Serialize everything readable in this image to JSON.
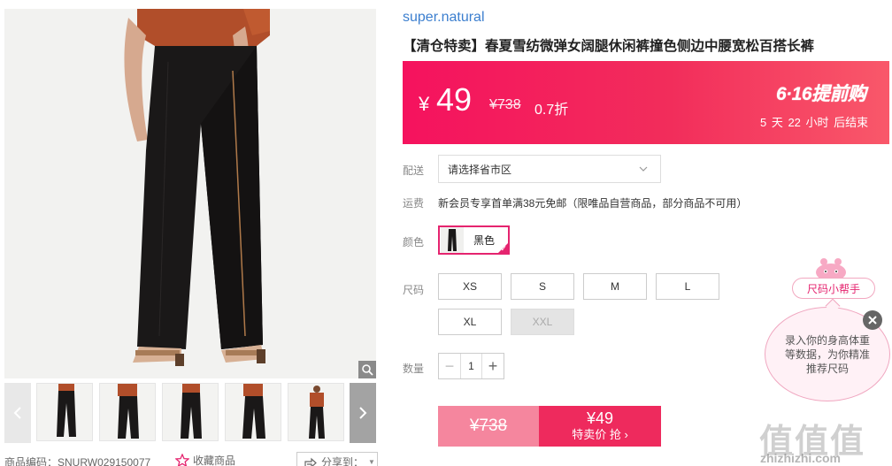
{
  "gallery": {
    "zoom_icon": "magnifier-icon",
    "prev_icon": "chevron-left-icon",
    "next_icon": "chevron-right-icon",
    "thumbnails": [
      "thumb-1",
      "thumb-2",
      "thumb-3",
      "thumb-4",
      "thumb-5"
    ]
  },
  "meta": {
    "product_code": "商品编码：SNURW029150077",
    "favorite_label": "收藏商品",
    "share_label": "分享到："
  },
  "product": {
    "brand": "super.natural",
    "title": "【清仓特卖】春夏雪纺微弹女阔腿休闲裤撞色侧边中腰宽松百搭长裤"
  },
  "price_banner": {
    "currency": "¥",
    "price": "49",
    "original_price": "¥738",
    "discount": "0.7折",
    "promo_logo": "6·16提前购",
    "countdown": "5 天 22 小时 后结束",
    "colors": {
      "start": "#f5125e",
      "end": "#f9586a"
    }
  },
  "delivery": {
    "label": "配送",
    "placeholder": "请选择省市区"
  },
  "shipping": {
    "label": "运费",
    "text": "新会员专享首单满38元免邮（限唯品自营商品，部分商品不可用）"
  },
  "color": {
    "label": "颜色",
    "options": [
      {
        "name": "黑色",
        "selected": true
      }
    ]
  },
  "size": {
    "label": "尺码",
    "options": [
      {
        "name": "XS",
        "available": true
      },
      {
        "name": "S",
        "available": true
      },
      {
        "name": "M",
        "available": true
      },
      {
        "name": "L",
        "available": true
      },
      {
        "name": "XL",
        "available": true
      },
      {
        "name": "XXL",
        "available": false
      }
    ]
  },
  "quantity": {
    "label": "数量",
    "value": "1",
    "minus": "−",
    "plus": "+"
  },
  "buy": {
    "original_price": "¥738",
    "price": "¥49",
    "button_label": "特卖价 抢 ›",
    "accent": "#ee2a5d"
  },
  "size_helper": {
    "tag": "尺码小帮手",
    "message": "录入你的身高体重等数据，为你精准推荐尺码",
    "close_icon": "close-icon"
  },
  "watermark": {
    "logo": "值值值",
    "text": "zhizhizhi.com"
  }
}
